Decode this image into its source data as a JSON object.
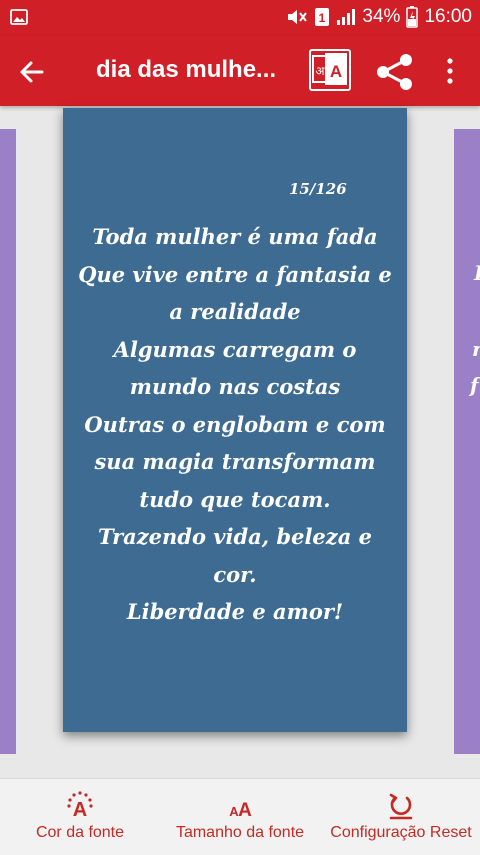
{
  "status_bar": {
    "battery": "34%",
    "time": "16:00",
    "sim": "1"
  },
  "app_bar": {
    "title": "dia das mulhe...",
    "translate_label": "अ A"
  },
  "card": {
    "counter": "15/126",
    "lines": [
      "Toda mulher é uma fada",
      "Que vive entre a fantasia e",
      "a realidade",
      "Algumas carregam o",
      "mundo nas costas",
      "Outras o englobam e com",
      "sua magia transformam",
      "tudo que tocam.",
      "Trazendo vida, beleza e",
      "cor.",
      "Liberdade e amor!"
    ]
  },
  "side_card_right": {
    "visible_chars": [
      "I",
      "n",
      "f"
    ]
  },
  "bottom_bar": {
    "font_color_label": "Cor da fonte",
    "font_size_label": "Tamanho da fonte",
    "reset_label": "Configuração Reset"
  },
  "colors": {
    "primary": "#d01f26",
    "card": "#3d6b91",
    "side_card": "#9b7fc7",
    "accent_text": "#c42a24"
  },
  "icons": [
    "image-icon",
    "mute-icon",
    "sim-icon",
    "signal-icon",
    "battery-icon",
    "back-arrow-icon",
    "translate-icon",
    "share-icon",
    "more-vert-icon",
    "font-color-icon",
    "font-size-icon",
    "reset-icon"
  ]
}
